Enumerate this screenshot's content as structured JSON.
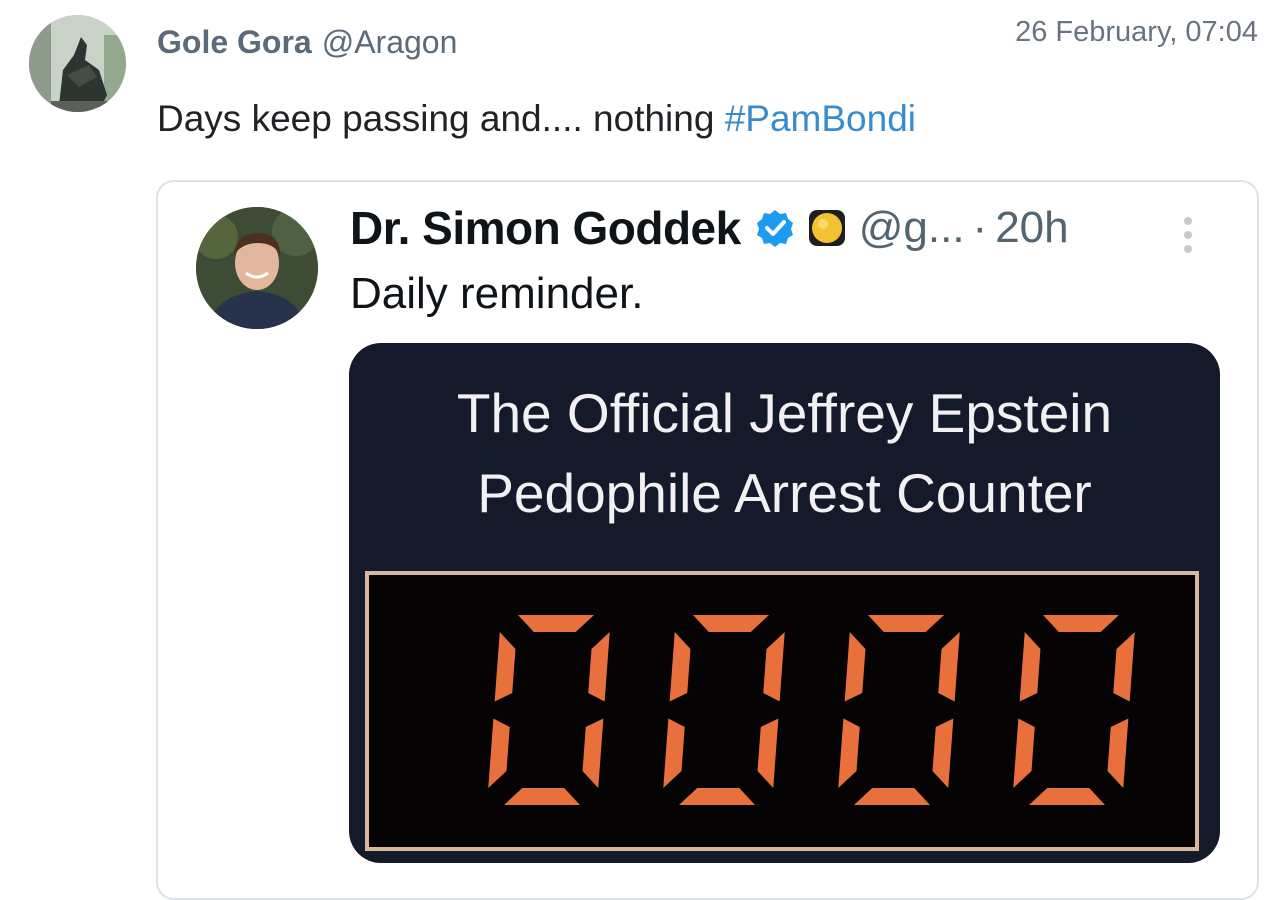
{
  "post": {
    "author_name": "Gole Gora",
    "author_handle": "@Aragon",
    "timestamp": "26 February, 07:04",
    "text": "Days keep passing and.... nothing ",
    "hashtag": "#PamBondi"
  },
  "quoted": {
    "author_name": "Dr. Simon Goddek",
    "handle": "@g...",
    "separator": "·",
    "time": "20h",
    "text": "Daily reminder.",
    "media": {
      "title_line1": "The Official Jeffrey Epstein",
      "title_line2": "Pedophile Arrest Counter",
      "counter_value": "0000"
    }
  },
  "colors": {
    "hashtag": "#3a8ccc",
    "counter_digit": "#e8703c",
    "verified_badge": "#1d9bf0"
  }
}
